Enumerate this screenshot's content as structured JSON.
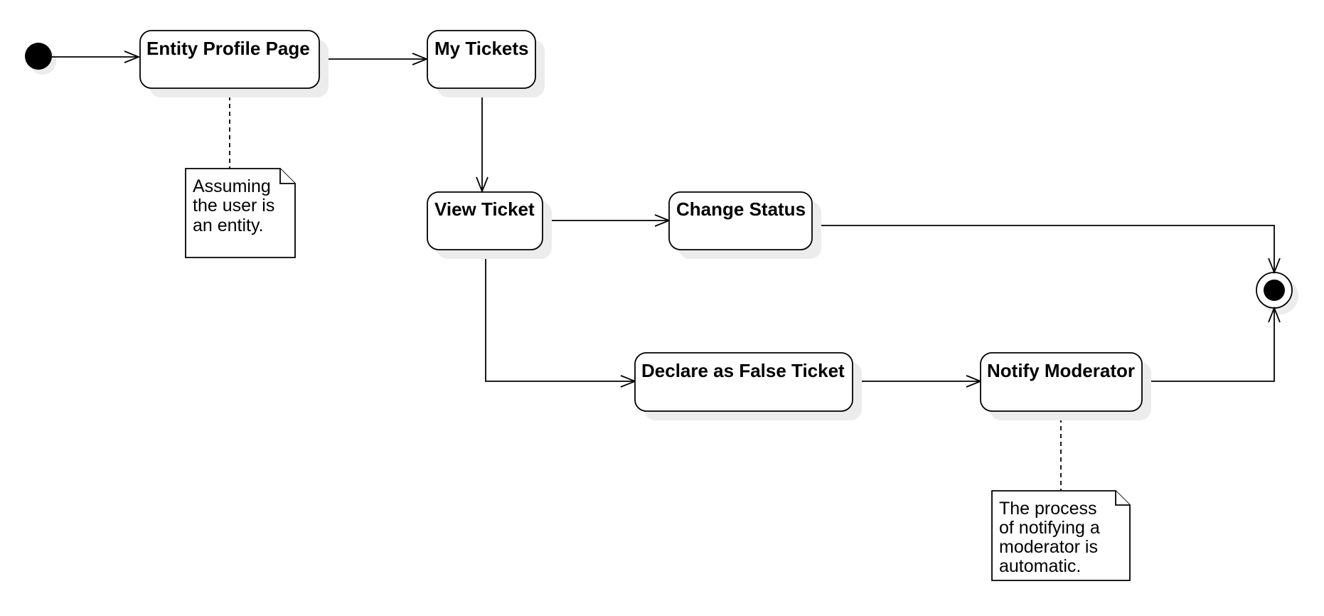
{
  "diagram": {
    "states": {
      "entity_profile_page": "Entity Profile Page",
      "my_tickets": "My Tickets",
      "view_ticket": "View Ticket",
      "change_status": "Change Status",
      "declare_false_ticket": "Declare as False Ticket",
      "notify_moderator": "Notify Moderator"
    },
    "notes": {
      "entity_note": [
        "Assuming",
        "the user is",
        "an entity."
      ],
      "moderator_note": [
        "The process",
        "of notifying a",
        "moderator is",
        "automatic."
      ]
    },
    "colors": {
      "stroke": "#000000",
      "fill": "#ffffff",
      "shadow": "#ececec"
    }
  }
}
